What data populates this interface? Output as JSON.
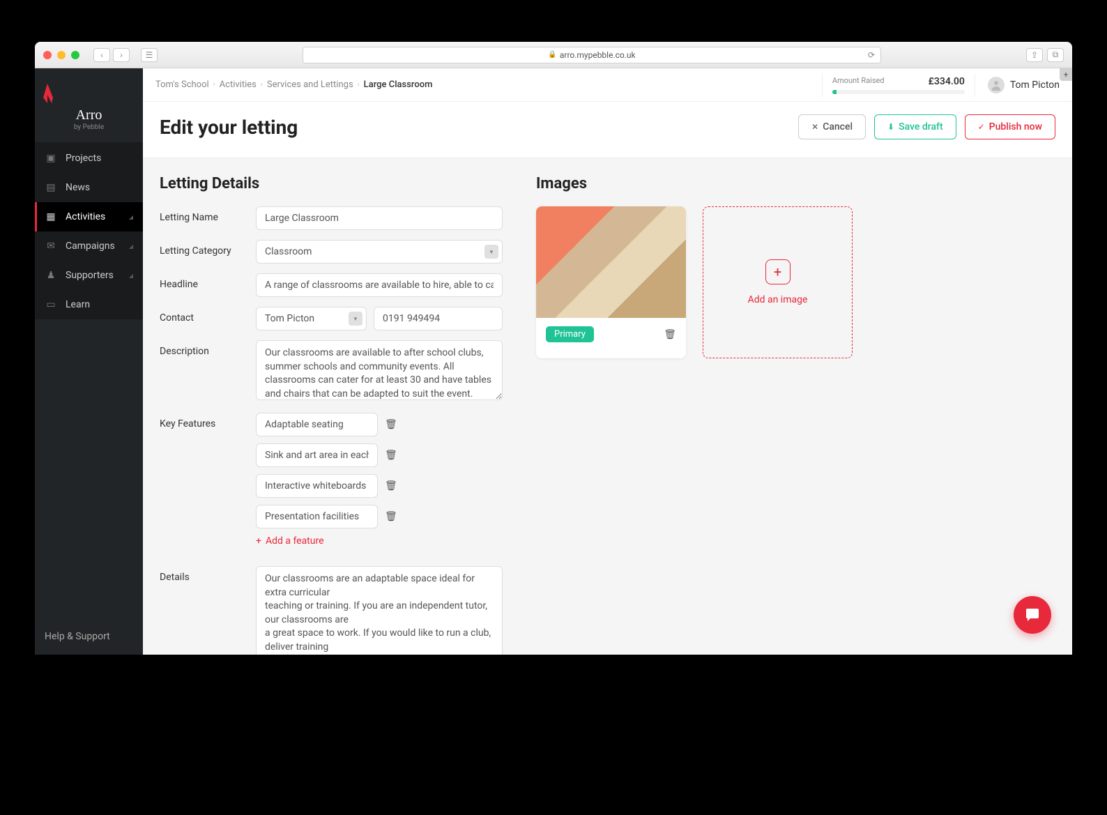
{
  "browser": {
    "url": "arro.mypebble.co.uk"
  },
  "logo": {
    "name": "Arro",
    "sub": "by Pebble"
  },
  "sidebar": {
    "items": [
      {
        "label": "Projects",
        "active": false
      },
      {
        "label": "News",
        "active": false
      },
      {
        "label": "Activities",
        "active": true
      },
      {
        "label": "Campaigns",
        "active": false
      },
      {
        "label": "Supporters",
        "active": false
      },
      {
        "label": "Learn",
        "active": false
      }
    ],
    "footer": "Help & Support"
  },
  "breadcrumb": {
    "parts": [
      "Tom's School",
      "Activities",
      "Services and Lettings"
    ],
    "current": "Large Classroom"
  },
  "raised": {
    "label": "Amount Raised",
    "amount": "£334.00"
  },
  "user": {
    "name": "Tom Picton"
  },
  "page": {
    "title": "Edit your letting"
  },
  "actions": {
    "cancel": "Cancel",
    "save": "Save draft",
    "publish": "Publish now"
  },
  "leftCol": {
    "title": "Letting Details",
    "labels": {
      "name": "Letting Name",
      "category": "Letting Category",
      "headline": "Headline",
      "contact": "Contact",
      "description": "Description",
      "features": "Key Features",
      "details": "Details"
    },
    "values": {
      "name": "Large Classroom",
      "category": "Classroom",
      "headline": "A range of classrooms are available to hire, able to cater",
      "contact_name": "Tom Picton",
      "contact_phone": "0191 949494",
      "description": "Our classrooms are available to after school clubs, summer schools and community events. All classrooms can cater for at least 30 and have tables and chairs that can be adapted to suit the event.",
      "features": [
        "Adaptable seating",
        "Sink and art area in each",
        "Interactive whiteboards",
        "Presentation facilities"
      ],
      "add_feature": "Add a feature",
      "details": "Our classrooms are an adaptable space ideal for extra curricular\nteaching or training. If you are an independent tutor, our classrooms are\na great space to work. If you would like to run a club, deliver training\nor deliver a small scale event, our classrooms are the perfect space."
    }
  },
  "rightCol": {
    "title": "Images",
    "badge": "Primary",
    "add_label": "Add an image"
  }
}
